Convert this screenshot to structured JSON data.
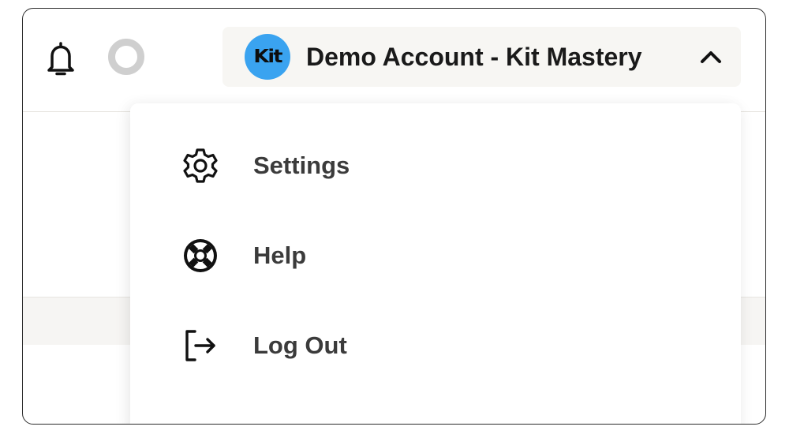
{
  "header": {
    "notifications_icon": "bell-icon",
    "user_avatar": "avatar-placeholder",
    "account": {
      "logo_text": "Kit",
      "logo_color": "#3aa3f0",
      "name": "Demo Account - Kit Mastery",
      "toggle_icon": "chevron-up-icon"
    }
  },
  "menu": {
    "items": [
      {
        "label": "Settings",
        "icon": "gear-icon"
      },
      {
        "label": "Help",
        "icon": "lifebuoy-icon"
      },
      {
        "label": "Log Out",
        "icon": "logout-icon"
      }
    ]
  }
}
